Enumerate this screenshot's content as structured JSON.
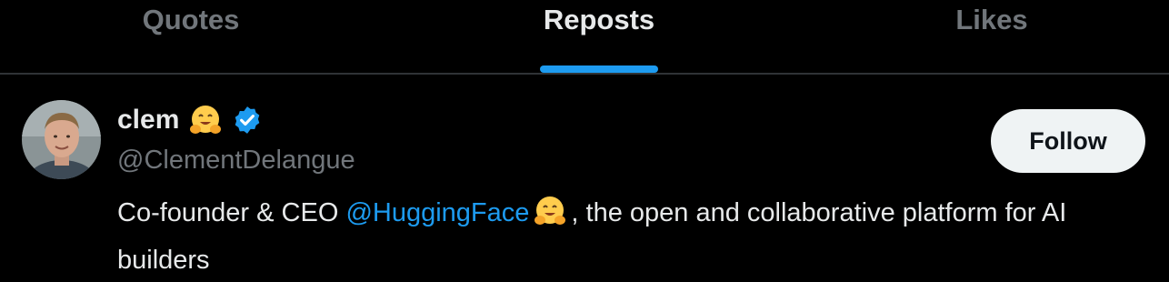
{
  "tabs": [
    {
      "label": "Quotes",
      "active": false
    },
    {
      "label": "Reposts",
      "active": true
    },
    {
      "label": "Likes",
      "active": false
    }
  ],
  "user": {
    "display_name": "clem",
    "name_emoji": "hugging-face-emoji",
    "verified_badge": "verified-badge-icon",
    "handle": "@ClementDelangue",
    "follow_label": "Follow",
    "bio": {
      "prefix": "Co-founder & CEO ",
      "mention": "@HuggingFace",
      "emoji": "hugging-face-emoji",
      "suffix": ", the open and collaborative platform for AI builders"
    }
  },
  "colors": {
    "background": "#000000",
    "accent": "#1d9bf0",
    "muted_text": "#71767b",
    "primary_text": "#e7e9ea",
    "follow_button_bg": "#eff3f4"
  }
}
